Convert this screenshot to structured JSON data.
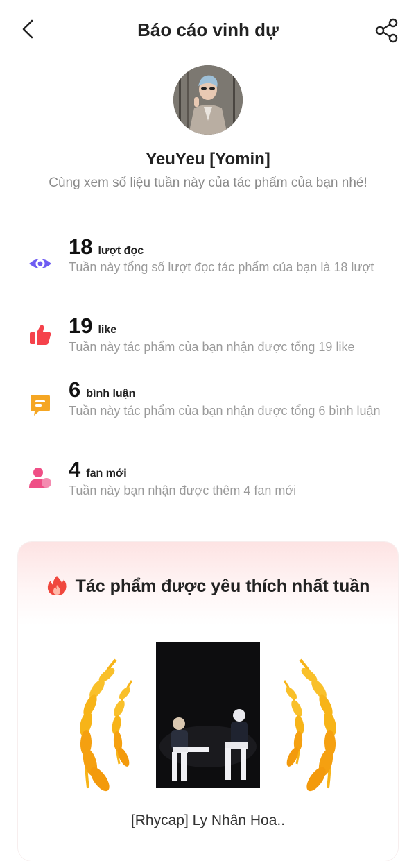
{
  "header": {
    "title": "Báo cáo vinh dự"
  },
  "profile": {
    "name": "YeuYeu [Yomin]",
    "subtitle": "Cùng xem số liệu tuần này của tác phẩm của bạn nhé!"
  },
  "stats": [
    {
      "number": "18",
      "unit": "lượt đọc",
      "desc": "Tuần này tổng số lượt đọc tác phẩm của bạn là 18 lượt",
      "icon": "eye-icon"
    },
    {
      "number": "19",
      "unit": "like",
      "desc": "Tuần này tác phẩm của bạn nhận được tổng 19 like",
      "icon": "thumbs-up-icon"
    },
    {
      "number": "6",
      "unit": "bình luận",
      "desc": "Tuần này tác phẩm của bạn nhận được tổng 6 bình luận",
      "icon": "comment-icon"
    },
    {
      "number": "4",
      "unit": "fan mới",
      "desc": "Tuần này bạn nhận được thêm 4 fan mới",
      "icon": "user-icon"
    }
  ],
  "favorite": {
    "title": "Tác phẩm được yêu thích nhất tuần",
    "book_title": "[Rhycap] Ly Nhân Hoa.."
  },
  "colors": {
    "eye": "#6f5cf2",
    "like": "#f5424b",
    "comment": "#f5a623",
    "fan": "#ef4f86",
    "laurel": "#f7b418",
    "card_top": "#fde3e3"
  }
}
